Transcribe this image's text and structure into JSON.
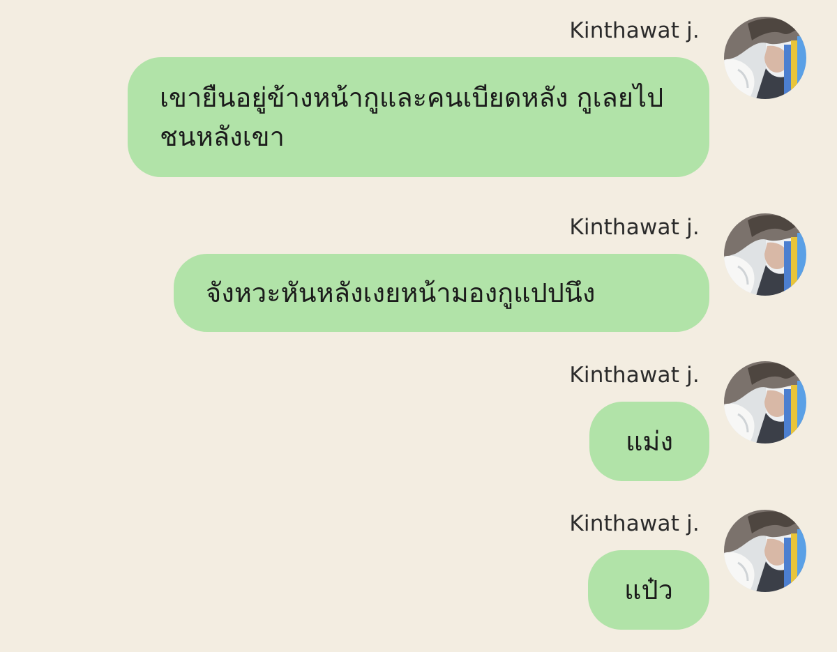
{
  "theme": {
    "background": "#f3ede1",
    "bubble_color": "#b1e3a8"
  },
  "messages": [
    {
      "sender": "Kinthawat j.",
      "text": "เขายืนอยู่ข้างหน้ากูและคนเบียดหลัง กูเลยไปชนหลังเขา",
      "avatar_icon": "user-avatar-photo"
    },
    {
      "sender": "Kinthawat j.",
      "text": "จังหวะหันหลังเงยหน้ามองกูแปปนึง",
      "avatar_icon": "user-avatar-photo"
    },
    {
      "sender": "Kinthawat j.",
      "text": "แม่ง",
      "avatar_icon": "user-avatar-photo"
    },
    {
      "sender": "Kinthawat j.",
      "text": "แป๋ว",
      "avatar_icon": "user-avatar-photo"
    }
  ]
}
